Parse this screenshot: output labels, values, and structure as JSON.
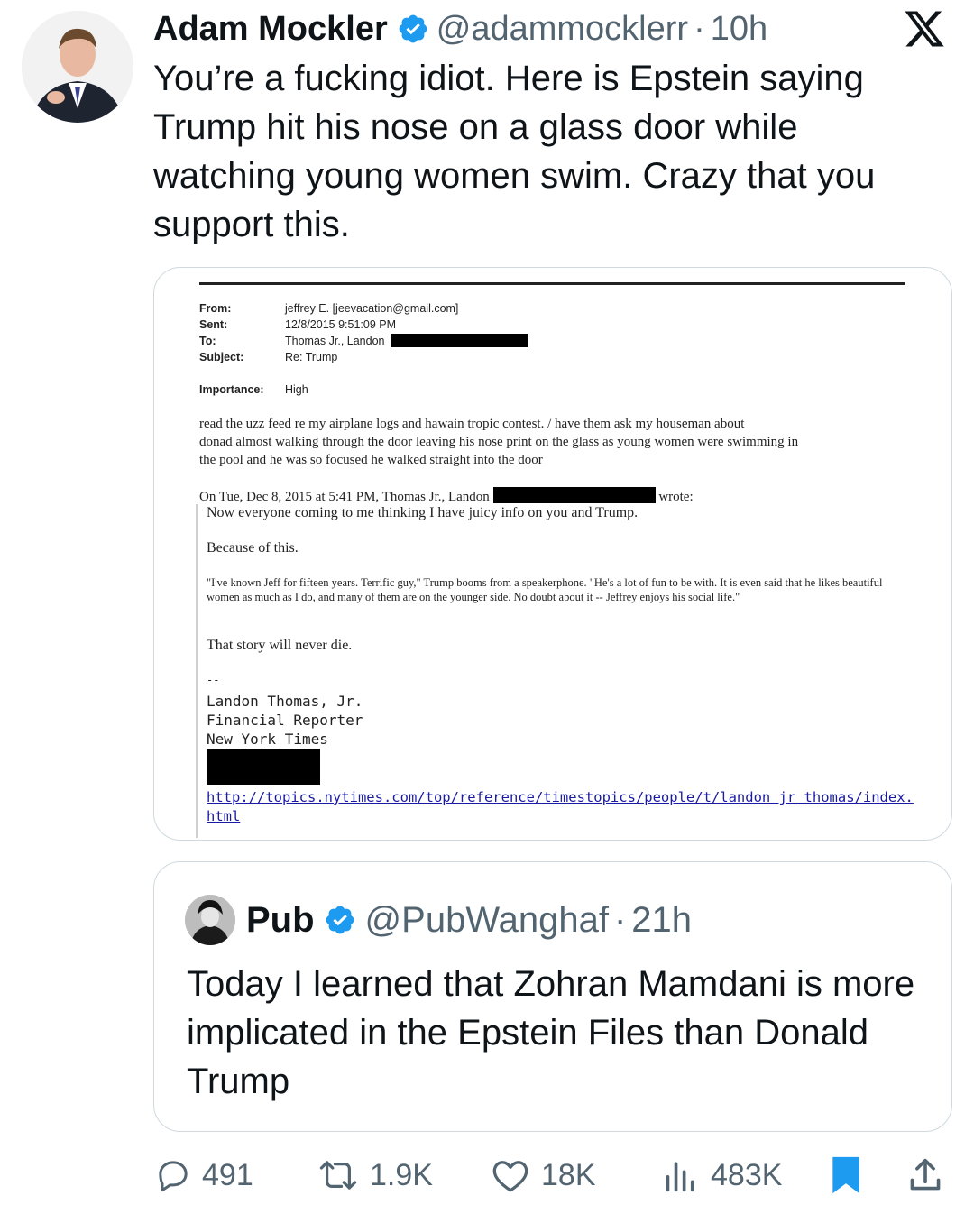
{
  "tweet": {
    "author_name": "Adam Mockler",
    "handle": "@adammocklerr",
    "separator": "·",
    "time": "10h",
    "text": "You’re a fucking idiot. Here is Epstein saying Trump hit his nose on a glass door while watching young women swim. Crazy that you support this."
  },
  "document": {
    "from_label": "From:",
    "from_value": "jeffrey E. [jeevacation@gmail.com]",
    "sent_label": "Sent:",
    "sent_value": "12/8/2015 9:51:09 PM",
    "to_label": "To:",
    "to_value": "Thomas Jr., Landon",
    "subject_label": "Subject:",
    "subject_value": "Re: Trump",
    "importance_label": "Importance:",
    "importance_value": "High",
    "body_line1": "read the uzz feed re my airplane logs  and hawain tropic contest. /   have them ask my houseman about",
    "body_line2": "donad  almost walking through the door leaving his nose  print on the glass as young women were swimming in",
    "body_line3": "the pool and he was so focused he walked straight into the door",
    "reply_header_pre": "On Tue, Dec 8, 2015 at 5:41 PM, Thomas Jr., Landon",
    "reply_header_post": "wrote:",
    "quoted_line1": "Now everyone coming to me thinking I have juicy info on you and Trump.",
    "quoted_line2": "Because of this.",
    "quoted_snippet": "\"I've known Jeff for fifteen years. Terrific guy,\" Trump booms from a speakerphone. \"He's a lot of fun to be with. It is even said that he likes beautiful women as much as I do, and many of them are on the younger side. No doubt about it -- Jeffrey enjoys his social life.\"",
    "quoted_line3": "That story will never die.",
    "sig_dash": "--",
    "sig_name": "Landon Thomas, Jr.",
    "sig_title": "Financial Reporter",
    "sig_org": "New York Times",
    "link": "http://topics.nytimes.com/top/reference/timestopics/people/t/landon_jr_thomas/index.html"
  },
  "quoted_tweet": {
    "author_name": "Pub",
    "handle": "@PubWanghaf",
    "separator": "·",
    "time": "21h",
    "text": "Today I learned that Zohran Mamdani is more implicated in the Epstein Files than Donald Trump"
  },
  "actions": {
    "replies": "491",
    "reposts": "1.9K",
    "likes": "18K",
    "views": "483K"
  },
  "colors": {
    "verified_blue": "#1d9bf0",
    "secondary_text": "#536471",
    "bookmark_blue": "#1d9bf0"
  },
  "icons": [
    "verified-badge-icon",
    "x-logo-icon",
    "reply-icon",
    "repost-icon",
    "like-icon",
    "views-icon",
    "bookmark-icon",
    "share-icon"
  ]
}
